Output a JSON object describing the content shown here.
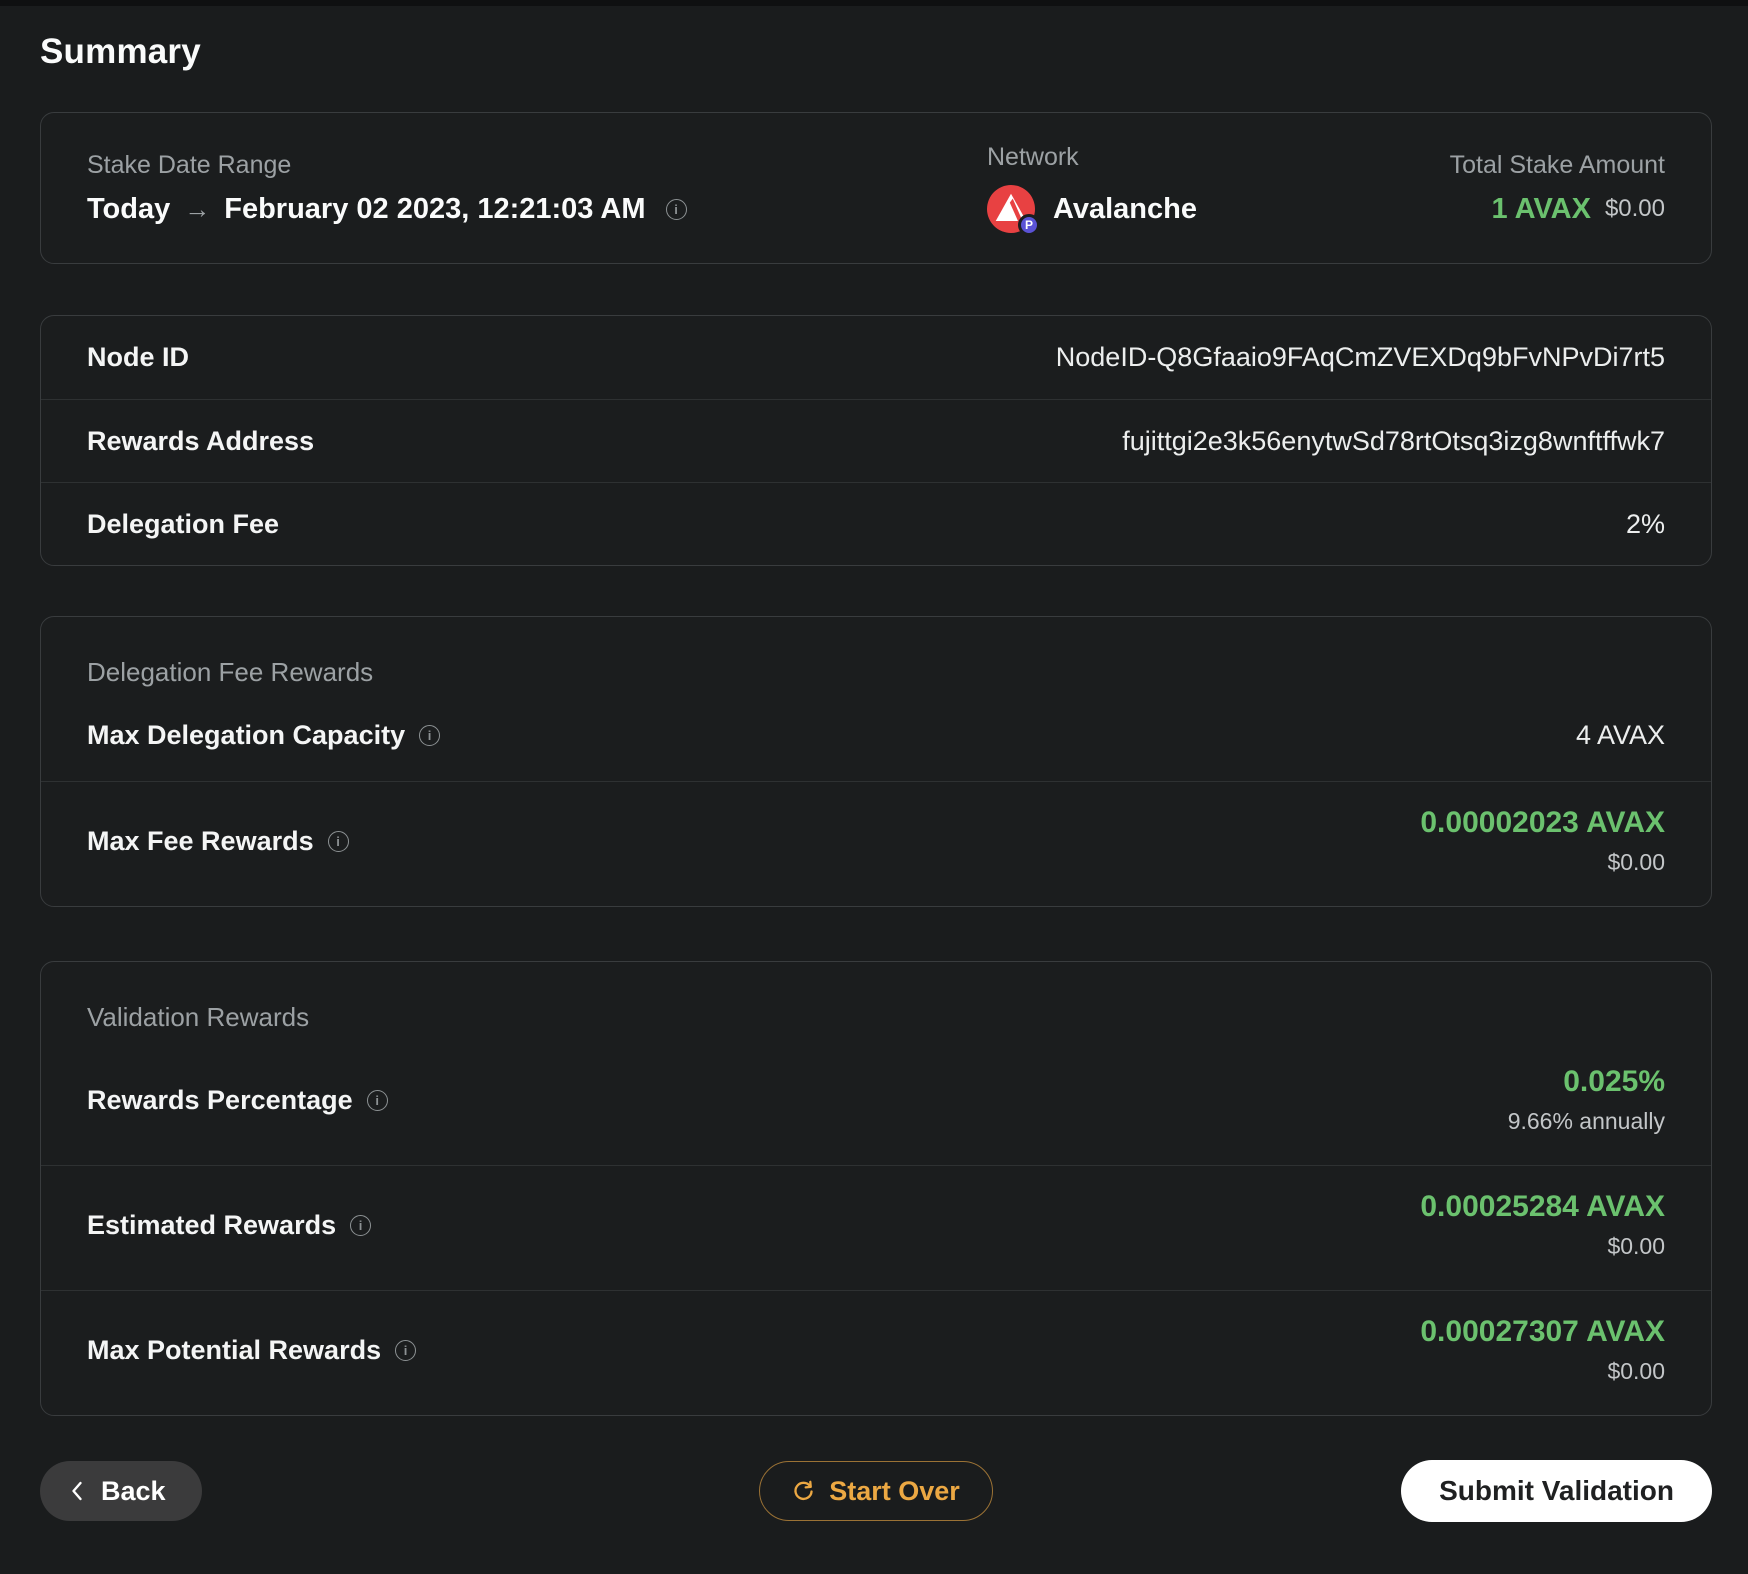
{
  "page": {
    "title": "Summary"
  },
  "icons": {
    "info_glyph": "i"
  },
  "colors": {
    "green": "#6bc16e",
    "orange": "#eca843",
    "avalanche_red": "#e84142",
    "badge_purple": "#5a52d5"
  },
  "top_card": {
    "stake_date_range_label": "Stake Date Range",
    "stake_start": "Today",
    "arrow": "→",
    "stake_end": "February 02 2023, 12:21:03 AM",
    "network_label": "Network",
    "network_name": "Avalanche",
    "network_badge": "P",
    "total_stake_label": "Total Stake Amount",
    "total_stake_value": "1 AVAX",
    "total_stake_usd": "$0.00"
  },
  "details_card": {
    "rows": [
      {
        "label": "Node ID",
        "value": "NodeID-Q8Gfaaio9FAqCmZVEXDq9bFvNPvDi7rt5"
      },
      {
        "label": "Rewards Address",
        "value": "fujittgi2e3k56enytwSd78rtOtsq3izg8wnftffwk7"
      },
      {
        "label": "Delegation Fee",
        "value": "2%"
      }
    ]
  },
  "delegation_fee_rewards_card": {
    "header": "Delegation Fee Rewards",
    "capacity_row": {
      "label": "Max Delegation Capacity",
      "value": "4 AVAX"
    },
    "fee_row": {
      "label": "Max Fee Rewards",
      "value": "0.00002023 AVAX",
      "sub_value": "$0.00"
    }
  },
  "validation_rewards_card": {
    "header": "Validation Rewards",
    "rows": [
      {
        "label": "Rewards Percentage",
        "value": "0.025%",
        "sub_value": "9.66% annually"
      },
      {
        "label": "Estimated Rewards",
        "value": "0.00025284 AVAX",
        "sub_value": "$0.00"
      },
      {
        "label": "Max Potential Rewards",
        "value": "0.00027307 AVAX",
        "sub_value": "$0.00"
      }
    ]
  },
  "footer": {
    "back_label": "Back",
    "start_over_label": "Start Over",
    "submit_label": "Submit Validation"
  }
}
